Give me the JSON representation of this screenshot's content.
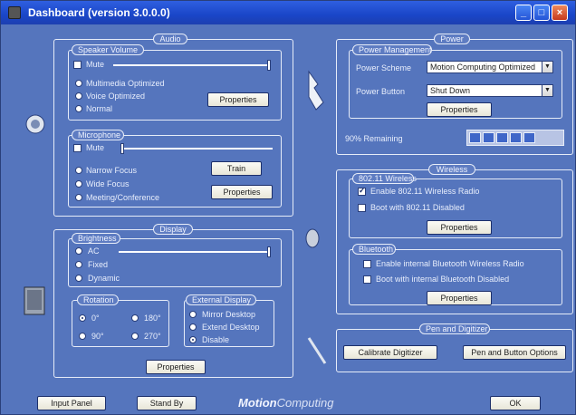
{
  "window": {
    "title": "Dashboard  (version 3.0.0.0)"
  },
  "titlebar": {
    "minimize": "_",
    "maximize": "□",
    "close": "×"
  },
  "audio": {
    "title": "Audio",
    "speaker": {
      "title": "Speaker Volume",
      "mute": "Mute",
      "modes": [
        "Multimedia Optimized",
        "Voice Optimized",
        "Normal"
      ],
      "properties": "Properties"
    },
    "microphone": {
      "title": "Microphone",
      "mute": "Mute",
      "modes": [
        "Narrow Focus",
        "Wide Focus",
        "Meeting/Conference"
      ],
      "train": "Train",
      "properties": "Properties"
    }
  },
  "display": {
    "title": "Display",
    "brightness": {
      "title": "Brightness",
      "modes": [
        "AC",
        "Fixed",
        "Dynamic"
      ]
    },
    "rotation": {
      "title": "Rotation",
      "options": [
        "0°",
        "90°",
        "180°",
        "270°"
      ]
    },
    "external": {
      "title": "External Display",
      "options": [
        "Mirror Desktop",
        "Extend Desktop",
        "Disable"
      ]
    },
    "properties": "Properties"
  },
  "power": {
    "title": "Power",
    "management": {
      "title": "Power Management",
      "scheme_label": "Power Scheme",
      "scheme_value": "Motion Computing Optimized",
      "button_label": "Power Button",
      "button_value": "Shut Down",
      "properties": "Properties"
    },
    "battery_label": "90% Remaining",
    "battery_level": 0.9
  },
  "wireless": {
    "title": "Wireless",
    "wifi": {
      "title": "802.11 Wireless",
      "enable": "Enable 802.11 Wireless Radio",
      "boot": "Boot with 802.11 Disabled",
      "properties": "Properties"
    },
    "bluetooth": {
      "title": "Bluetooth",
      "enable": "Enable internal Bluetooth Wireless Radio",
      "boot": "Boot with internal Bluetooth Disabled",
      "properties": "Properties"
    }
  },
  "pen": {
    "title": "Pen and Digitizer",
    "calibrate": "Calibrate Digitizer",
    "options": "Pen and Button Options"
  },
  "footer": {
    "input_panel": "Input Panel",
    "stand_by": "Stand By",
    "brand_motion": "Motion",
    "brand_computing": "Computing",
    "ok": "OK"
  }
}
